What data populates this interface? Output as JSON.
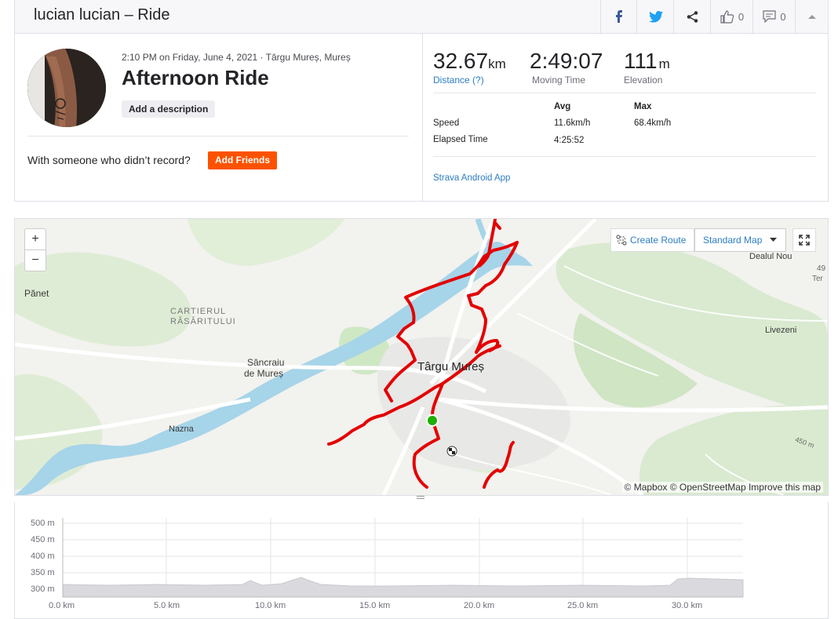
{
  "header": {
    "title": "lucian lucian – Ride",
    "kudos_count": "0",
    "comment_count": "0"
  },
  "activity": {
    "datetime": "2:10 PM on Friday, June 4, 2021 · Târgu Mureș, Mureș",
    "name": "Afternoon Ride",
    "add_description": "Add a description",
    "with_someone": "With someone who didn’t record?",
    "add_friends": "Add Friends"
  },
  "stats": {
    "distance": {
      "value": "32.67",
      "unit": "km",
      "label": "Distance (?)"
    },
    "moving_time": {
      "value": "2:49:07",
      "label": "Moving Time"
    },
    "elevation": {
      "value": "111",
      "unit": "m",
      "label": "Elevation"
    },
    "col_avg": "Avg",
    "col_max": "Max",
    "rows": [
      {
        "label": "Speed",
        "avg": "11.6km/h",
        "max": "68.4km/h"
      },
      {
        "label": "Elapsed Time",
        "avg": "4:25:52",
        "max": ""
      }
    ],
    "device": "Strava Android App"
  },
  "map": {
    "zoom_in": "+",
    "zoom_out": "−",
    "create_route": "Create Route",
    "map_style": "Standard Map",
    "attribution": "© Mapbox © OpenStreetMap Improve this map",
    "labels": {
      "city": "Târgu Mureș",
      "panet": "Pănet",
      "cartierul": "CARTIERUL",
      "rasaritului": "RĂSĂRITULUI",
      "sancraiu1": "Sâncraiu",
      "sancraiu2": "de Mureș",
      "nazna": "Nazna",
      "dealul": "Dealul Nou",
      "livezeni": "Livezeni",
      "contour": "450 m",
      "edge1": "49",
      "edge2": "Ter"
    }
  },
  "elevation_chart": {
    "y_ticks": [
      "500 m",
      "450 m",
      "400 m",
      "350 m",
      "300 m"
    ],
    "x_ticks": [
      "0.0 km",
      "5.0 km",
      "10.0 km",
      "15.0 km",
      "20.0 km",
      "25.0 km",
      "30.0 km"
    ]
  },
  "colors": {
    "accent": "#fc5200",
    "route": "#e30000",
    "link": "#2d7dc3",
    "water": "#a6d4e9",
    "park": "#cfe8c4"
  }
}
